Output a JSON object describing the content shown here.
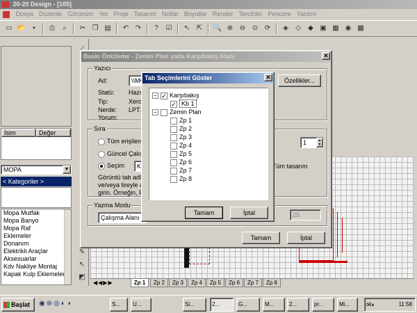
{
  "window": {
    "title": "20-20 Design - [105]"
  },
  "menu": [
    "Dosya",
    "Düzenle",
    "Görünüm",
    "Yer",
    "Proje",
    "Tasarım",
    "Notlar",
    "Boyutlar",
    "Render",
    "Tercihler",
    "Pencere",
    "Yardım"
  ],
  "left_panel": {
    "grid_headers": [
      "İsim",
      "Değer"
    ],
    "catalog_select": "MOPA",
    "category_select": "< Kategoriler >",
    "catalog_items": [
      "Mopa Mutfak",
      "Mopa Banyo",
      "Mopa Raf",
      "Eklemeler",
      "Donanım",
      "Elektrikli Araçlar",
      "Aksesuarlar",
      "Kdv Nakliye Montaj",
      "Kapak Kulp Eklemeleri"
    ]
  },
  "print_dialog": {
    "title": "Baskı Önizleme - Zemin Plan yada Karşıbakış Alanı",
    "printer_group": "Yazıcı",
    "name_label": "Ad:",
    "name_value": "\\\\MO",
    "properties_button": "Özellikler...",
    "rows": [
      {
        "label": "Statü:",
        "value": "Hazır"
      },
      {
        "label": "Tip:",
        "value": "Xerox"
      },
      {
        "label": "Nerde:",
        "value": "LPT1"
      },
      {
        "label": "Yorum:",
        "value": ""
      }
    ],
    "order_group": "Sıra",
    "radio_all": "Tüm erişilen g",
    "radio_current": "Güncel Çalışm",
    "radio_select": "Seçim",
    "select_value": "Kb",
    "copies_value": "1",
    "all_designs": "Tüm tasarım",
    "hint_text": [
      "Görüntü tab adları",
      "ve/veya tireyle ay",
      "girin. Örneğin, Fp1"
    ],
    "mode_group": "Yazma Modu",
    "mode_value": "Çalışma Alanı",
    "scale_value": "25",
    "ok_button": "Tamam",
    "cancel_button": "İptal"
  },
  "tab_dialog": {
    "title": "Tab Seçimlerini Göster",
    "tree": [
      {
        "label": "Karşıbakış",
        "level": 0,
        "expander": "−",
        "checked": true
      },
      {
        "label": "Kb 1",
        "level": 1,
        "checked": true,
        "selected": true
      },
      {
        "label": "Zemin Plan",
        "level": 0,
        "expander": "−",
        "checked": false
      },
      {
        "label": "Zp 1",
        "level": 1,
        "checked": false
      },
      {
        "label": "Zp 2",
        "level": 1,
        "checked": false
      },
      {
        "label": "Zp 3",
        "level": 1,
        "checked": false
      },
      {
        "label": "Zp 4",
        "level": 1,
        "checked": false
      },
      {
        "label": "Zp 5",
        "level": 1,
        "checked": false
      },
      {
        "label": "Zp 6",
        "level": 1,
        "checked": false
      },
      {
        "label": "Zp 7",
        "level": 1,
        "checked": false
      },
      {
        "label": "Zp 8",
        "level": 1,
        "checked": false
      }
    ],
    "ok_button": "Tamam",
    "cancel_button": "İptal"
  },
  "view_tabs": [
    "Zp 1",
    "Zp 2",
    "Zp 3",
    "Zp 4",
    "Zp 5",
    "Zp 6",
    "Zp 7",
    "Zp 8"
  ],
  "taskbar": {
    "start": "Başlat",
    "items": [
      "S...",
      "U...",
      "Si...",
      "2...",
      "G...",
      "M...",
      "2...",
      "pr...",
      "Mi..."
    ],
    "clock": "11:58"
  }
}
